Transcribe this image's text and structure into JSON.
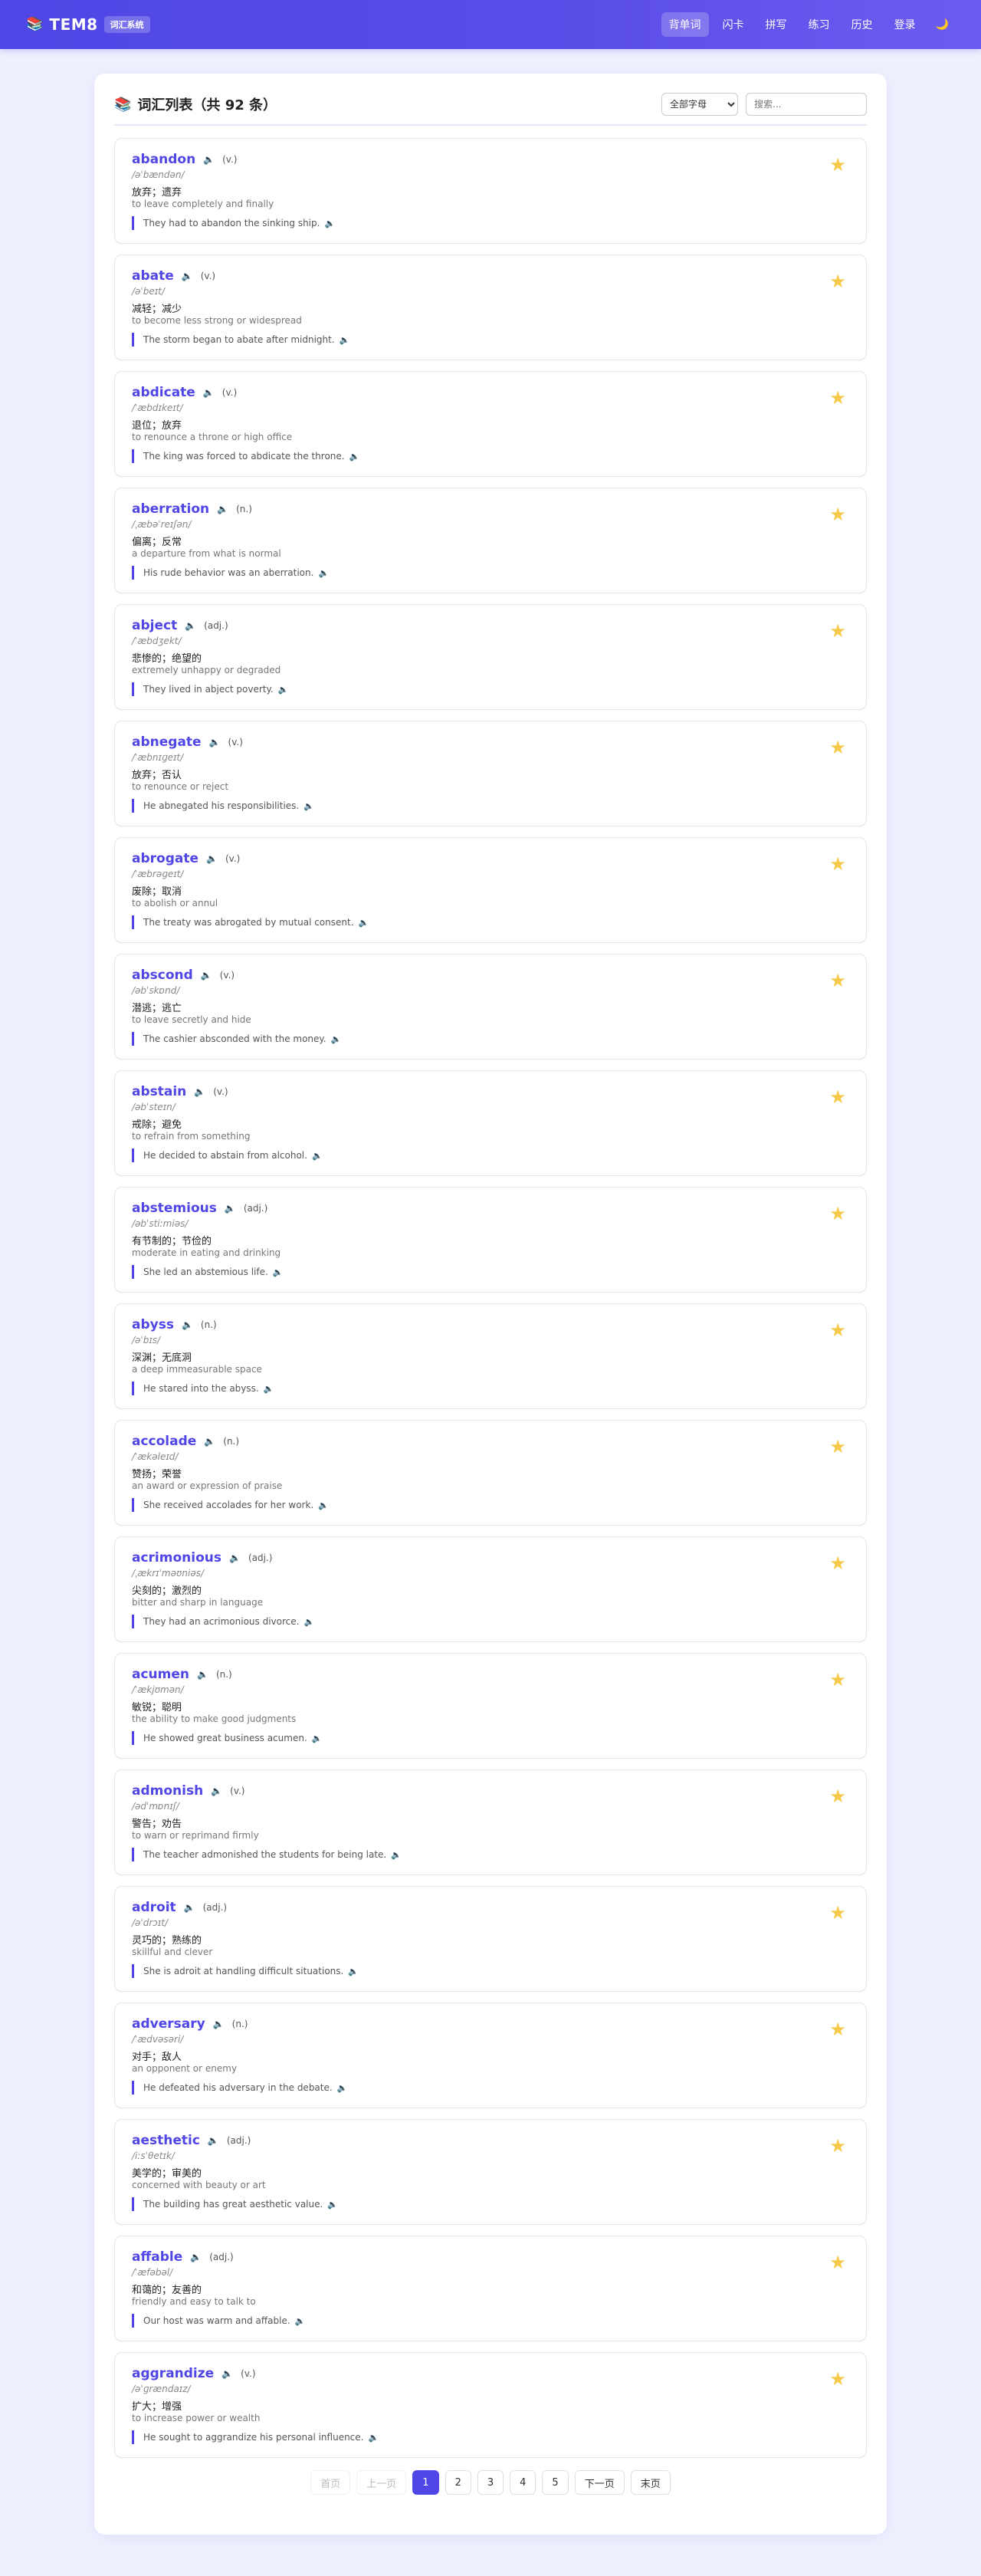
{
  "app": {
    "logo_icon": "books-icon",
    "title": "TEM8",
    "badge": "词汇系统"
  },
  "nav": {
    "items": [
      {
        "label": "背单词",
        "active": true
      },
      {
        "label": "闪卡",
        "active": false
      },
      {
        "label": "拼写",
        "active": false
      },
      {
        "label": "练习",
        "active": false
      },
      {
        "label": "历史",
        "active": false
      },
      {
        "label": "登录",
        "active": false
      }
    ],
    "theme_icon": "moon-icon"
  },
  "list": {
    "title": "词汇列表（共 92 条）",
    "filter_value": "全部字母",
    "search_placeholder": "搜索..."
  },
  "words": [
    {
      "term": "abandon",
      "pos": "(v.)",
      "phonetic": "/əˈbændən/",
      "cn": "放弃；遗弃",
      "en": "to leave completely and finally",
      "example": "They had to abandon the sinking ship."
    },
    {
      "term": "abate",
      "pos": "(v.)",
      "phonetic": "/əˈbeɪt/",
      "cn": "减轻；减少",
      "en": "to become less strong or widespread",
      "example": "The storm began to abate after midnight."
    },
    {
      "term": "abdicate",
      "pos": "(v.)",
      "phonetic": "/ˈæbdɪkeɪt/",
      "cn": "退位；放弃",
      "en": "to renounce a throne or high office",
      "example": "The king was forced to abdicate the throne."
    },
    {
      "term": "aberration",
      "pos": "(n.)",
      "phonetic": "/ˌæbəˈreɪʃən/",
      "cn": "偏离；反常",
      "en": "a departure from what is normal",
      "example": "His rude behavior was an aberration."
    },
    {
      "term": "abject",
      "pos": "(adj.)",
      "phonetic": "/ˈæbdʒekt/",
      "cn": "悲惨的；绝望的",
      "en": "extremely unhappy or degraded",
      "example": "They lived in abject poverty."
    },
    {
      "term": "abnegate",
      "pos": "(v.)",
      "phonetic": "/ˈæbnɪɡeɪt/",
      "cn": "放弃；否认",
      "en": "to renounce or reject",
      "example": "He abnegated his responsibilities."
    },
    {
      "term": "abrogate",
      "pos": "(v.)",
      "phonetic": "/ˈæbrəɡeɪt/",
      "cn": "废除；取消",
      "en": "to abolish or annul",
      "example": "The treaty was abrogated by mutual consent."
    },
    {
      "term": "abscond",
      "pos": "(v.)",
      "phonetic": "/əbˈskɒnd/",
      "cn": "潜逃；逃亡",
      "en": "to leave secretly and hide",
      "example": "The cashier absconded with the money."
    },
    {
      "term": "abstain",
      "pos": "(v.)",
      "phonetic": "/əbˈsteɪn/",
      "cn": "戒除；避免",
      "en": "to refrain from something",
      "example": "He decided to abstain from alcohol."
    },
    {
      "term": "abstemious",
      "pos": "(adj.)",
      "phonetic": "/əbˈstiːmiəs/",
      "cn": "有节制的；节俭的",
      "en": "moderate in eating and drinking",
      "example": "She led an abstemious life."
    },
    {
      "term": "abyss",
      "pos": "(n.)",
      "phonetic": "/əˈbɪs/",
      "cn": "深渊；无底洞",
      "en": "a deep immeasurable space",
      "example": "He stared into the abyss."
    },
    {
      "term": "accolade",
      "pos": "(n.)",
      "phonetic": "/ˈækəleɪd/",
      "cn": "赞扬；荣誉",
      "en": "an award or expression of praise",
      "example": "She received accolades for her work."
    },
    {
      "term": "acrimonious",
      "pos": "(adj.)",
      "phonetic": "/ˌækrɪˈməʊniəs/",
      "cn": "尖刻的；激烈的",
      "en": "bitter and sharp in language",
      "example": "They had an acrimonious divorce."
    },
    {
      "term": "acumen",
      "pos": "(n.)",
      "phonetic": "/ˈækjʊmən/",
      "cn": "敏锐；聪明",
      "en": "the ability to make good judgments",
      "example": "He showed great business acumen."
    },
    {
      "term": "admonish",
      "pos": "(v.)",
      "phonetic": "/ədˈmɒnɪʃ/",
      "cn": "警告；劝告",
      "en": "to warn or reprimand firmly",
      "example": "The teacher admonished the students for being late."
    },
    {
      "term": "adroit",
      "pos": "(adj.)",
      "phonetic": "/əˈdrɔɪt/",
      "cn": "灵巧的；熟练的",
      "en": "skillful and clever",
      "example": "She is adroit at handling difficult situations."
    },
    {
      "term": "adversary",
      "pos": "(n.)",
      "phonetic": "/ˈædvəsəri/",
      "cn": "对手；敌人",
      "en": "an opponent or enemy",
      "example": "He defeated his adversary in the debate."
    },
    {
      "term": "aesthetic",
      "pos": "(adj.)",
      "phonetic": "/iːsˈθetɪk/",
      "cn": "美学的；审美的",
      "en": "concerned with beauty or art",
      "example": "The building has great aesthetic value."
    },
    {
      "term": "affable",
      "pos": "(adj.)",
      "phonetic": "/ˈæfəbəl/",
      "cn": "和蔼的；友善的",
      "en": "friendly and easy to talk to",
      "example": "Our host was warm and affable."
    },
    {
      "term": "aggrandize",
      "pos": "(v.)",
      "phonetic": "/əˈɡrændaɪz/",
      "cn": "扩大；增强",
      "en": "to increase power or wealth",
      "example": "He sought to aggrandize his personal influence."
    }
  ],
  "pagination": {
    "first": "首页",
    "prev": "上一页",
    "pages": [
      "1",
      "2",
      "3",
      "4",
      "5"
    ],
    "current": "1",
    "next": "下一页",
    "last": "末页"
  },
  "colors": {
    "accent": "#4f46e5",
    "star": "#f6c847"
  }
}
